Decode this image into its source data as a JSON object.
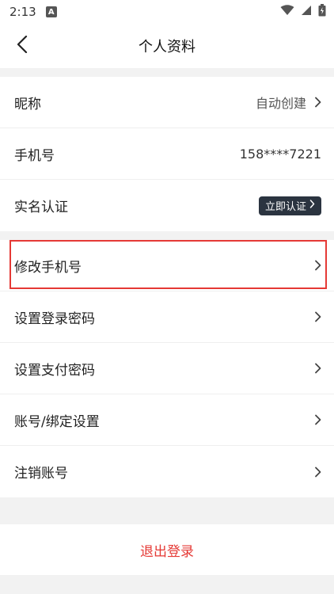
{
  "status_bar": {
    "time": "2:13",
    "app_badge": "A"
  },
  "nav": {
    "title": "个人资料",
    "back_icon": "chevron-left-icon"
  },
  "profile": {
    "nickname": {
      "label": "昵称",
      "value": "自动创建"
    },
    "phone": {
      "label": "手机号",
      "value": "158****7221"
    },
    "real_name": {
      "label": "实名认证",
      "button": "立即认证"
    }
  },
  "settings": [
    {
      "label": "修改手机号"
    },
    {
      "label": "设置登录密码"
    },
    {
      "label": "设置支付密码"
    },
    {
      "label": "账号/绑定设置"
    },
    {
      "label": "注销账号"
    }
  ],
  "logout_label": "退出登录",
  "colors": {
    "accent_red": "#e53935",
    "badge_dark": "#2b3440",
    "background": "#f2f2f2"
  }
}
